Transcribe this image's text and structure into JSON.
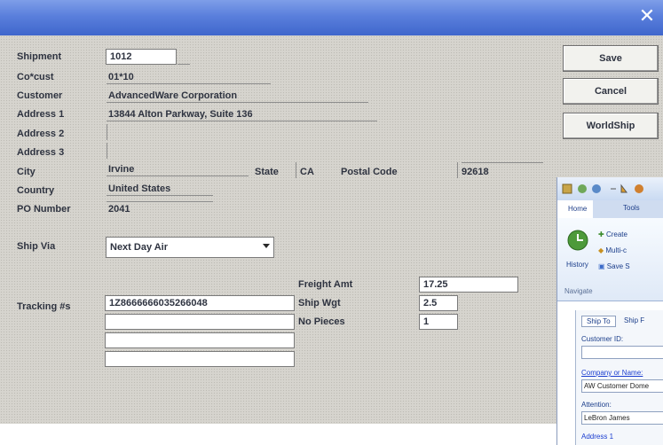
{
  "window": {
    "close_glyph": "✕"
  },
  "form": {
    "labels": {
      "shipment": "Shipment",
      "cocust": "Co*cust",
      "customer": "Customer",
      "address1": "Address 1",
      "address2": "Address 2",
      "address3": "Address 3",
      "city": "City",
      "state": "State",
      "postal_code": "Postal Code",
      "country": "Country",
      "po_number": "PO Number",
      "ship_via": "Ship Via",
      "tracking": "Tracking #s",
      "freight_amt": "Freight Amt",
      "ship_wgt": "Ship Wgt",
      "no_pieces": "No Pieces"
    },
    "values": {
      "shipment": "1012",
      "cocust": "01*10",
      "customer": "AdvancedWare Corporation",
      "address1": "13844 Alton Parkway, Suite 136",
      "address2": "",
      "address3": "",
      "city": "Irvine",
      "state": "CA",
      "postal_code": "92618",
      "country": "United States",
      "po_number": "2041",
      "ship_via": "Next Day Air",
      "tracking": [
        "1Z8666666035266048",
        "",
        "",
        ""
      ],
      "freight_amt": "17.25",
      "ship_wgt": "2.5",
      "no_pieces": "1"
    }
  },
  "buttons": {
    "save": "Save",
    "cancel": "Cancel",
    "worldship": "WorldShip"
  },
  "overlay": {
    "tabs": [
      "Home",
      "Tools"
    ],
    "history_label": "History",
    "ribbon_items": [
      "Create",
      "Multi-c",
      "Save S"
    ],
    "group_label": "Navigate",
    "panel_tabs": [
      "Ship To",
      "Ship F"
    ],
    "customer_id_label": "Customer ID:",
    "company_label": "Company or Name:",
    "company_value": "AW Customer Dome",
    "attention_label": "Attention:",
    "attention_value": "LeBron James",
    "address_label": "Address 1"
  }
}
